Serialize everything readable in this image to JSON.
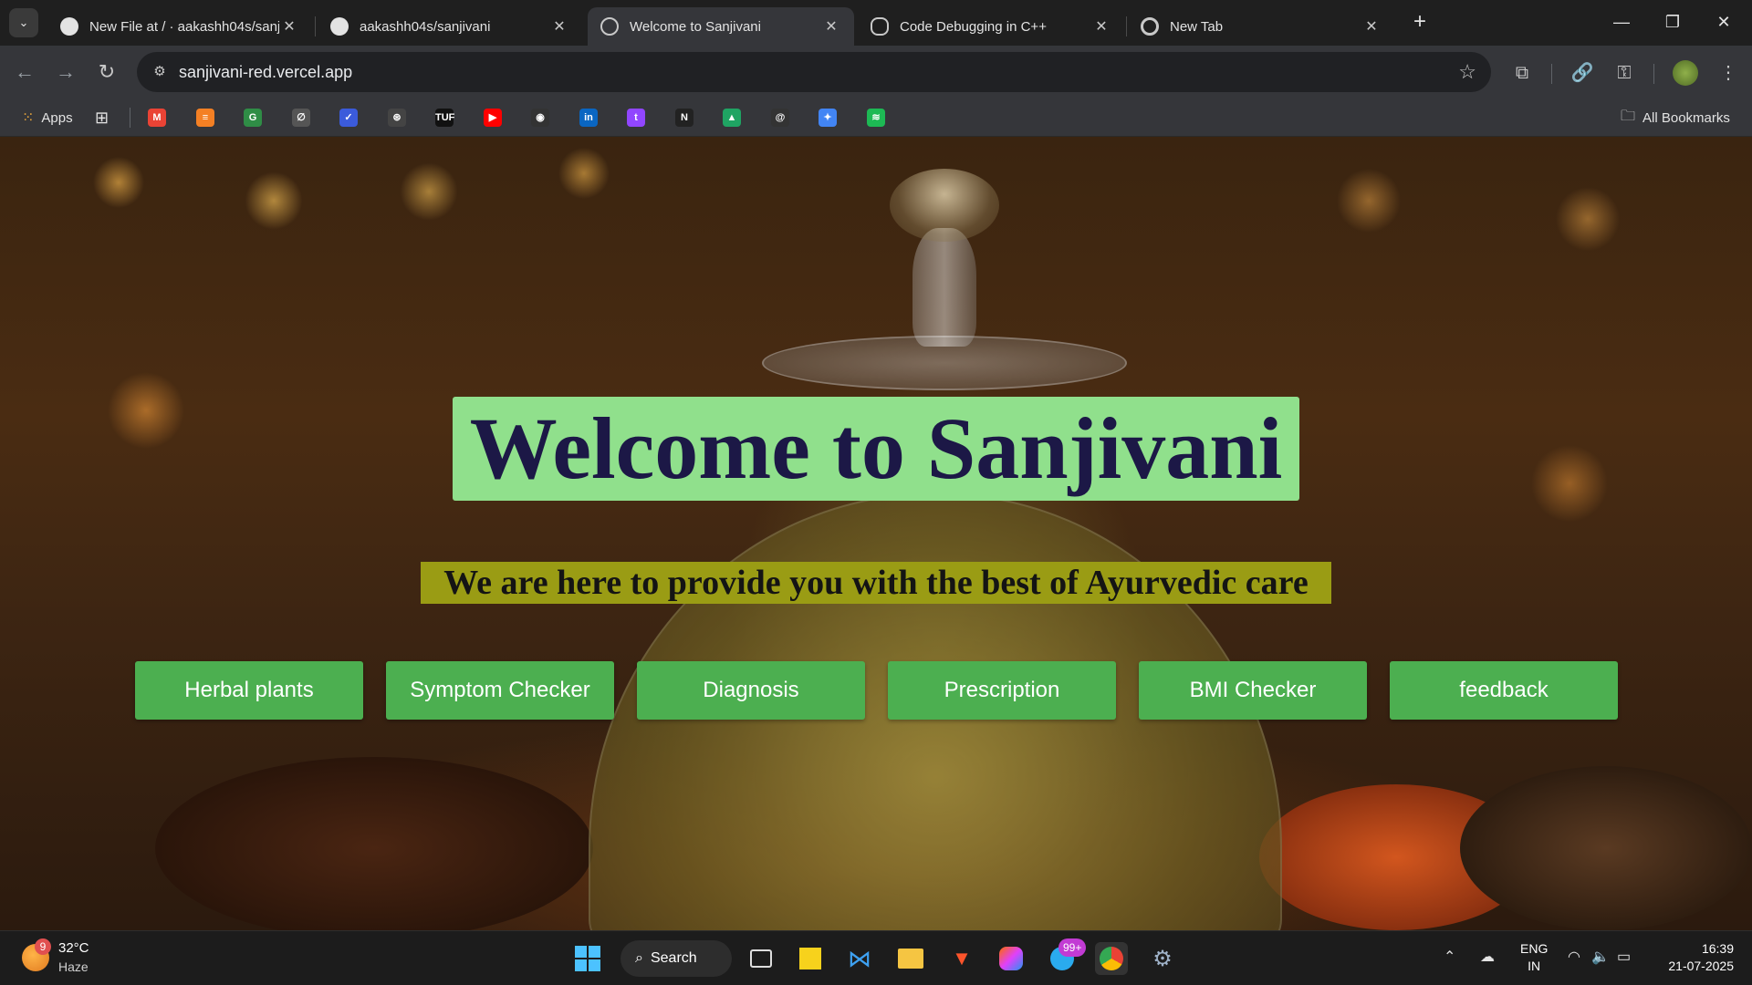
{
  "browser": {
    "tabs": [
      {
        "title": "New File at / · aakashh04s/sanji",
        "favicon": "github-icon",
        "active": false
      },
      {
        "title": "aakashh04s/sanjivani",
        "favicon": "github-icon",
        "active": false
      },
      {
        "title": "Welcome to Sanjivani",
        "favicon": "globe-icon",
        "active": true
      },
      {
        "title": "Code Debugging in C++",
        "favicon": "chatgpt-icon",
        "active": false
      },
      {
        "title": "New Tab",
        "favicon": "chrome-icon",
        "active": false
      }
    ],
    "close_glyph": "✕",
    "new_tab_glyph": "+",
    "url": "sanjivani-red.vercel.app",
    "bookmarks": {
      "apps_label": "Apps",
      "all_bookmarks_label": "All Bookmarks",
      "icons": [
        {
          "name": "gmail-icon",
          "glyph": "M",
          "color": "#ea4335"
        },
        {
          "name": "stackoverflow-icon",
          "glyph": "≡",
          "color": "#f48024"
        },
        {
          "name": "geeksforgeeks-icon",
          "glyph": "G",
          "color": "#2f8d46"
        },
        {
          "name": "leetcode-icon",
          "glyph": "∅",
          "color": "#555555"
        },
        {
          "name": "codeforces-icon",
          "glyph": "✓",
          "color": "#3b5bdb"
        },
        {
          "name": "chatgpt-icon",
          "glyph": "⊛",
          "color": "#444444"
        },
        {
          "name": "tuf-icon",
          "glyph": "TUF",
          "color": "#111111"
        },
        {
          "name": "youtube-icon",
          "glyph": "▶",
          "color": "#ff0000"
        },
        {
          "name": "github-icon",
          "glyph": "◉",
          "color": "#333333"
        },
        {
          "name": "linkedin-icon",
          "glyph": "in",
          "color": "#0a66c2"
        },
        {
          "name": "twitch-icon",
          "glyph": "t",
          "color": "#9146ff"
        },
        {
          "name": "notion-icon",
          "glyph": "N",
          "color": "#222222"
        },
        {
          "name": "google-drive-icon",
          "glyph": "▲",
          "color": "#1fa463"
        },
        {
          "name": "threads-icon",
          "glyph": "@",
          "color": "#333333"
        },
        {
          "name": "gemini-icon",
          "glyph": "✦",
          "color": "#4285f4"
        },
        {
          "name": "spotify-icon",
          "glyph": "≋",
          "color": "#1db954"
        }
      ]
    }
  },
  "page": {
    "heading": "Welcome to Sanjivani",
    "tagline": "We are here to provide you with the best of Ayurvedic care",
    "buttons": [
      "Herbal plants",
      "Symptom Checker",
      "Diagnosis",
      "Prescription",
      "BMI Checker",
      "feedback"
    ],
    "colors": {
      "heading_bg": "#90e08c",
      "heading_text": "#1c1846",
      "tagline_bg": "#9a9c14",
      "button_bg": "#4caf50"
    }
  },
  "taskbar": {
    "weather": {
      "temp": "32°C",
      "desc": "Haze",
      "badge": "9"
    },
    "search_label": "Search",
    "telegram_badge": "99+",
    "lang": {
      "line1": "ENG",
      "line2": "IN"
    },
    "time": "16:39",
    "date": "21-07-2025"
  }
}
